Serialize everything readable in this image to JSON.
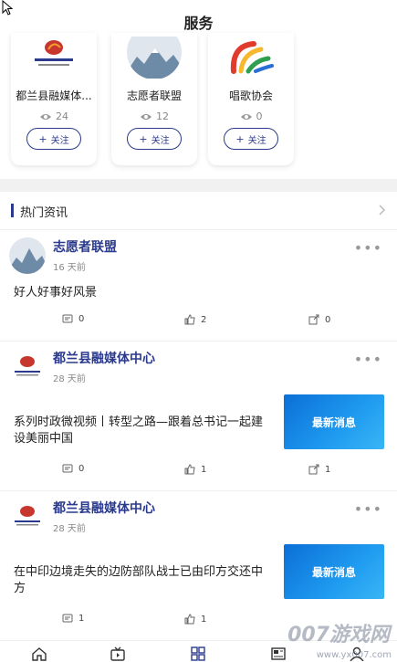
{
  "page_title": "服务",
  "services": [
    {
      "name": "都兰县融媒体...",
      "views": "24",
      "follow_label": "关注"
    },
    {
      "name": "志愿者联盟",
      "views": "12",
      "follow_label": "关注"
    },
    {
      "name": "唱歌协会",
      "views": "0",
      "follow_label": "关注"
    }
  ],
  "hot_section": {
    "title": "热门资讯"
  },
  "posts": [
    {
      "author": "志愿者联盟",
      "time": "16 天前",
      "text": "好人好事好风景",
      "comments": "0",
      "likes": "2",
      "shares": "0",
      "thumb_text": ""
    },
    {
      "author": "都兰县融媒体中心",
      "time": "28 天前",
      "text": "系列时政微视频丨转型之路—跟着总书记一起建设美丽中国",
      "comments": "0",
      "likes": "1",
      "shares": "1",
      "thumb_text": "最新消息"
    },
    {
      "author": "都兰县融媒体中心",
      "time": "28 天前",
      "text": "在中印边境走失的边防部队战士已由印方交还中方",
      "comments": "1",
      "likes": "1",
      "shares": "",
      "thumb_text": "最新消息"
    }
  ],
  "watermark": {
    "main": "007游戏网",
    "sub": "www.yx007.com"
  },
  "colors": {
    "accent": "#2b3a8c",
    "thumb_blue": "#1f8fe8"
  }
}
